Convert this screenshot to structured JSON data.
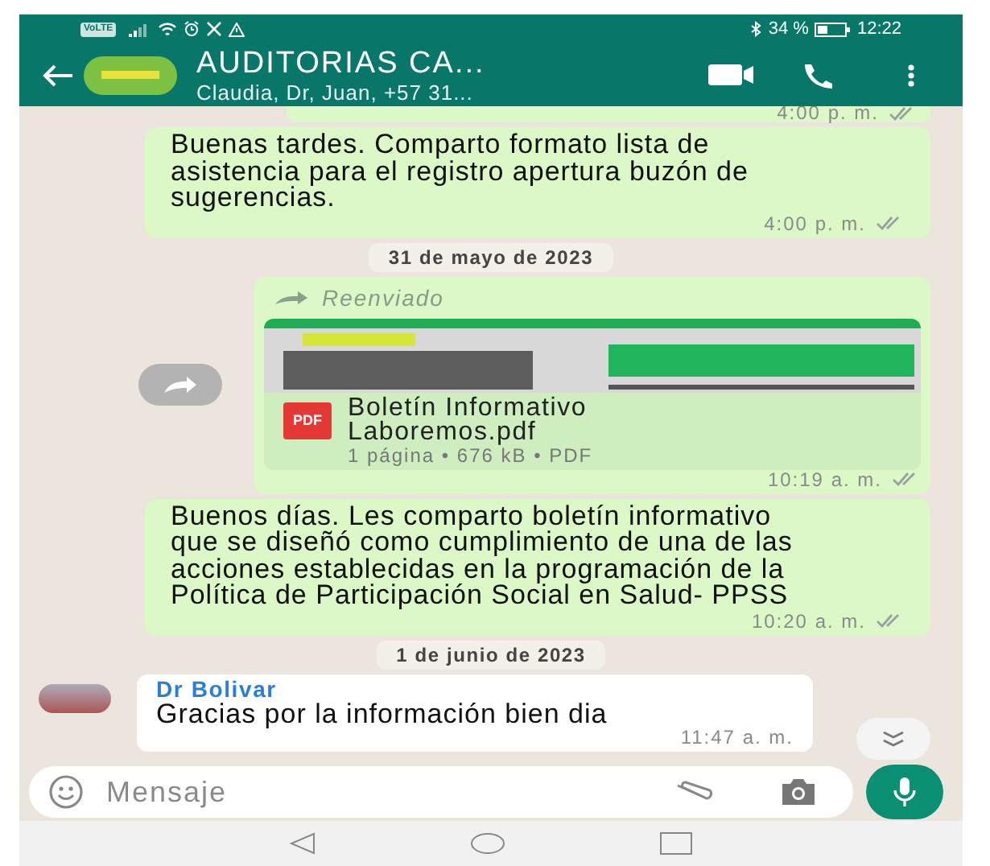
{
  "status_bar": {
    "carrier_badge": "VoLTE",
    "battery": "34 %",
    "time": "12:22"
  },
  "header": {
    "title": "AUDITORIAS CA...",
    "subtitle": "Claudia, Dr, Juan, +57 31..."
  },
  "messages": [
    {
      "kind": "tail",
      "time": "4:00 p. m."
    },
    {
      "kind": "text",
      "text": "Buenas tardes. Comparto formato lista de asistencia para el registro apertura buzón de sugerencias.",
      "time": "4:00 p. m."
    },
    {
      "kind": "date",
      "text": "31 de mayo de 2023"
    },
    {
      "kind": "document",
      "forwarded_label": "Reenviado",
      "file_name": "Boletín Informativo Laboremos.pdf",
      "file_badge": "PDF",
      "meta": "1 página • 676 kB • PDF",
      "time": "10:19 a. m."
    },
    {
      "kind": "text",
      "text": "Buenos días. Les comparto boletín informativo que se diseñó como cumplimiento de una de las acciones establecidas en la programación de la Política de Participación Social en Salud- PPSS",
      "time": "10:20 a. m."
    },
    {
      "kind": "date",
      "text": "1 de junio de 2023"
    },
    {
      "kind": "incoming",
      "sender": "Dr Bolivar",
      "text": "Gracias por la información bien dia",
      "time": "11:47 a. m."
    }
  ],
  "composer": {
    "placeholder": "Mensaje"
  }
}
